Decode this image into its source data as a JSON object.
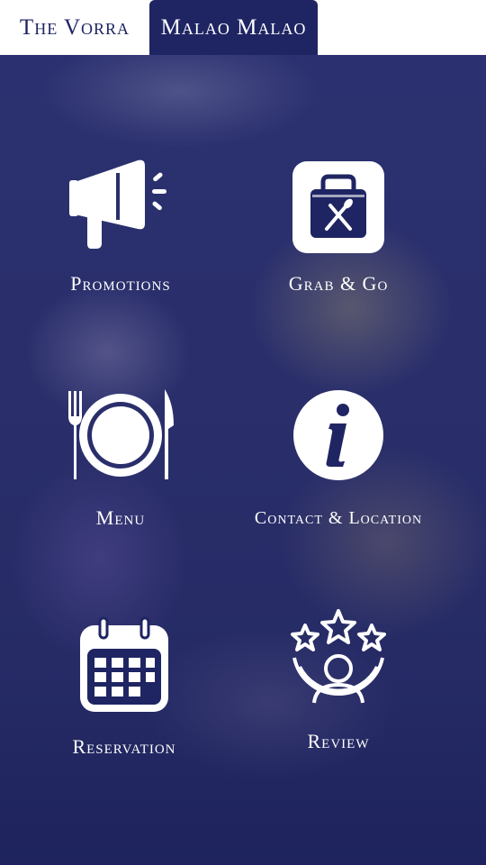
{
  "tabs": [
    {
      "label": "The Vorra"
    },
    {
      "label": "Malao Malao"
    }
  ],
  "tiles": [
    {
      "label": "Promotions",
      "icon": "megaphone-icon"
    },
    {
      "label": "Grab & Go",
      "icon": "takeaway-bag-icon"
    },
    {
      "label": "Menu",
      "icon": "plate-cutlery-icon"
    },
    {
      "label": "Contact & Location",
      "icon": "info-icon"
    },
    {
      "label": "Reservation",
      "icon": "calendar-icon"
    },
    {
      "label": "Review",
      "icon": "star-rating-user-icon"
    }
  ],
  "colors": {
    "brand_navy": "#1f2563",
    "tab_bar": "#ffffff",
    "icon_fill": "#ffffff"
  }
}
